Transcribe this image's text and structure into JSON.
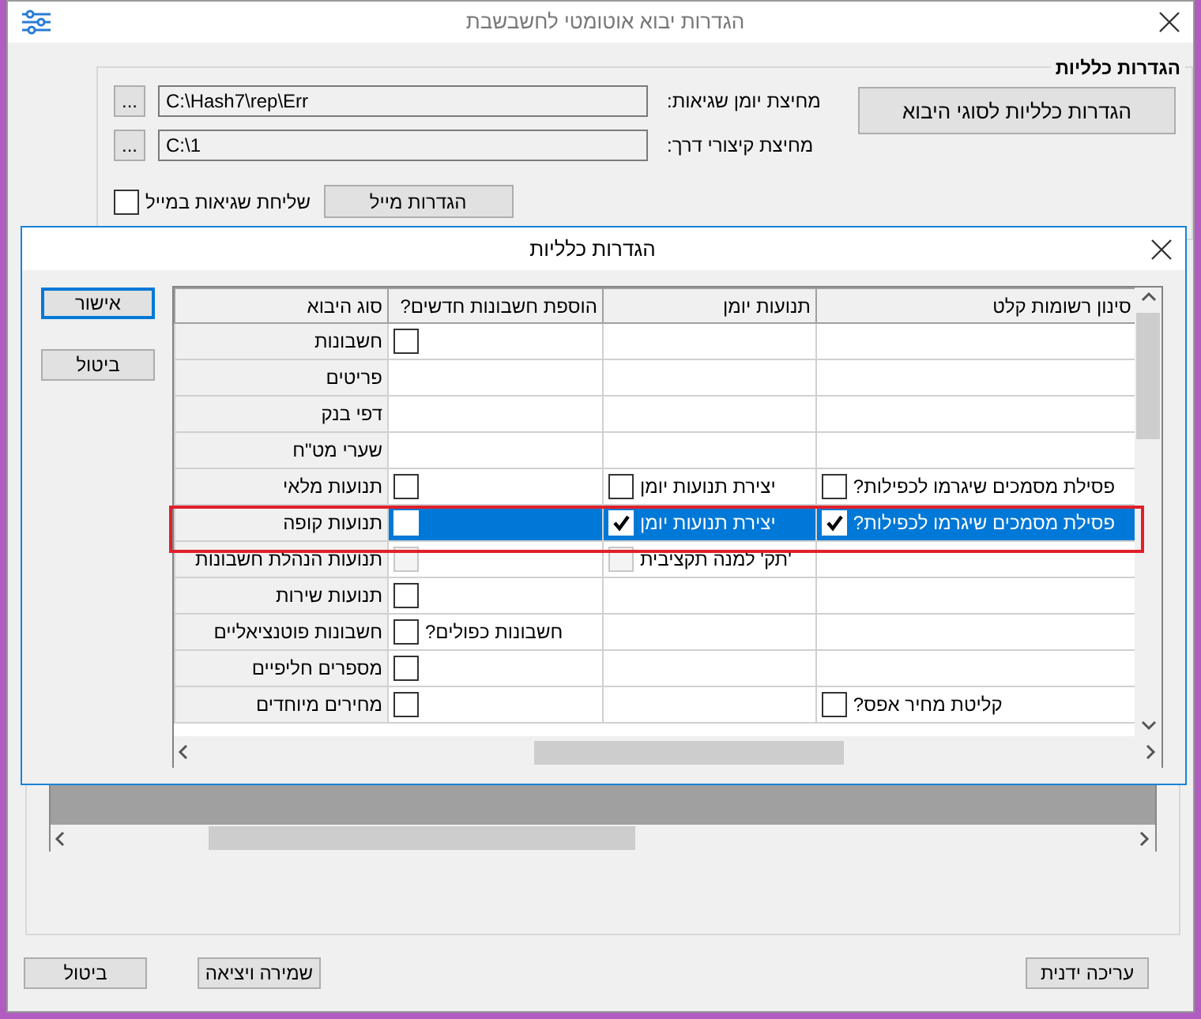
{
  "window": {
    "title": "הגדרות יבוא אוטומטי לחשבשבת"
  },
  "general": {
    "legend": "הגדרות כלליות",
    "types_button": "הגדרות כלליות לסוגי היבוא",
    "paths": [
      {
        "label": "מחיצת יומן שגיאות:",
        "value": "C:\\Hash7\\rep\\Err",
        "browse": "..."
      },
      {
        "label": "מחיצת קיצורי דרך:",
        "value": "C:\\1",
        "browse": "..."
      }
    ],
    "email_errors": {
      "label": "שליחת שגיאות במייל",
      "checked": false
    },
    "mail_button": "הגדרות מייל"
  },
  "dialog": {
    "title": "הגדרות כלליות",
    "buttons": [
      {
        "label": "אישור",
        "focused": true
      },
      {
        "label": "ביטול",
        "focused": false
      }
    ],
    "grid": {
      "columns": [
        "סינון רשומות קלט",
        "תנועות יומן",
        "הוספת חשבונות חדשים?",
        "סוג היבוא"
      ],
      "rows": [
        {
          "selected": false,
          "annotated": false,
          "cells": [
            {},
            {},
            {
              "checkbox": {
                "checked": false,
                "disabled": false
              }
            }
          ],
          "label": "חשבונות"
        },
        {
          "selected": false,
          "annotated": false,
          "cells": [
            {},
            {},
            {}
          ],
          "label": "פריטים"
        },
        {
          "selected": false,
          "annotated": false,
          "cells": [
            {},
            {},
            {}
          ],
          "label": "דפי בנק"
        },
        {
          "selected": false,
          "annotated": false,
          "cells": [
            {},
            {},
            {}
          ],
          "label": "שערי מט\"ח"
        },
        {
          "selected": false,
          "annotated": false,
          "cells": [
            {
              "checkbox": {
                "checked": false,
                "disabled": false
              },
              "text": "פסילת מסמכים שיגרמו לכפילות?"
            },
            {
              "checkbox": {
                "checked": false,
                "disabled": false
              },
              "text": "יצירת תנועות יומן"
            },
            {
              "checkbox": {
                "checked": false,
                "disabled": false
              }
            }
          ],
          "label": "תנועות מלאי"
        },
        {
          "selected": true,
          "annotated": true,
          "cells": [
            {
              "checkbox": {
                "checked": true,
                "disabled": false
              },
              "text": "פסילת מסמכים שיגרמו לכפילות?"
            },
            {
              "checkbox": {
                "checked": true,
                "disabled": false
              },
              "text": "יצירת תנועות יומן"
            },
            {
              "checkbox": {
                "checked": false,
                "disabled": false
              }
            }
          ],
          "label": "תנועות קופה"
        },
        {
          "selected": false,
          "annotated": false,
          "cells": [
            {},
            {
              "checkbox": {
                "checked": false,
                "disabled": true
              },
              "text": "'תק' למנה תקציבית"
            },
            {
              "checkbox": {
                "checked": false,
                "disabled": true
              }
            }
          ],
          "label": "תנועות הנהלת חשבונות"
        },
        {
          "selected": false,
          "annotated": false,
          "cells": [
            {},
            {},
            {
              "checkbox": {
                "checked": false,
                "disabled": false
              }
            }
          ],
          "label": "תנועות שירות"
        },
        {
          "selected": false,
          "annotated": false,
          "cells": [
            {},
            {},
            {
              "checkbox": {
                "checked": false,
                "disabled": false
              },
              "text": "חשבונות כפולים?"
            }
          ],
          "label": "חשבונות פוטנציאליים"
        },
        {
          "selected": false,
          "annotated": false,
          "cells": [
            {},
            {},
            {
              "checkbox": {
                "checked": false,
                "disabled": false
              }
            }
          ],
          "label": "מספרים חליפיים"
        },
        {
          "selected": false,
          "annotated": false,
          "cells": [
            {
              "checkbox": {
                "checked": false,
                "disabled": false
              },
              "text": "קליטת מחיר אפס?"
            },
            {},
            {
              "checkbox": {
                "checked": false,
                "disabled": false
              }
            }
          ],
          "label": "מחירים מיוחדים"
        }
      ]
    }
  },
  "footer": {
    "right_buttons": [
      "עריכה ידנית"
    ],
    "left_buttons": [
      "שמירה ויציאה",
      "ביטול"
    ]
  }
}
